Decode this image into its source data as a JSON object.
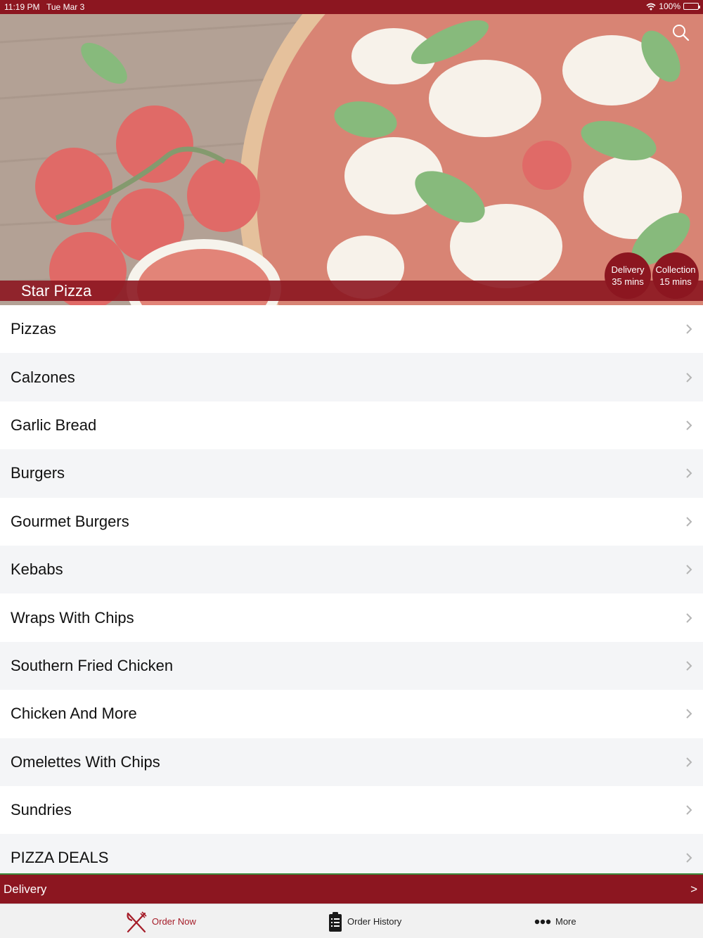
{
  "status_bar": {
    "time": "11:19 PM",
    "date": "Tue Mar 3",
    "battery": "100%"
  },
  "restaurant": {
    "name": "Star Pizza",
    "delivery": {
      "label": "Delivery",
      "time": "35 mins"
    },
    "collection": {
      "label": "Collection",
      "time": "15 mins"
    }
  },
  "icons": {
    "search": "search-icon",
    "chevron": "chevron-right-icon",
    "order_now": "fork-knife-icon",
    "order_history": "clipboard-list-icon",
    "more": "ellipsis-icon"
  },
  "colors": {
    "brand": "#8c1620",
    "active_tab": "#a51c28",
    "divider_accent": "#3c8a3c"
  },
  "menu": {
    "categories": [
      "Pizzas",
      "Calzones",
      "Garlic Bread",
      "Burgers",
      "Gourmet Burgers",
      "Kebabs",
      "Wraps With Chips",
      "Southern Fried Chicken",
      "Chicken And More",
      "Omelettes With Chips",
      "Sundries",
      "PIZZA DEALS"
    ]
  },
  "order_mode_bar": {
    "label": "Delivery",
    "arrow": ">"
  },
  "tab_bar": {
    "order_now": "Order Now",
    "order_history": "Order History",
    "more": "More",
    "active": "order_now"
  }
}
